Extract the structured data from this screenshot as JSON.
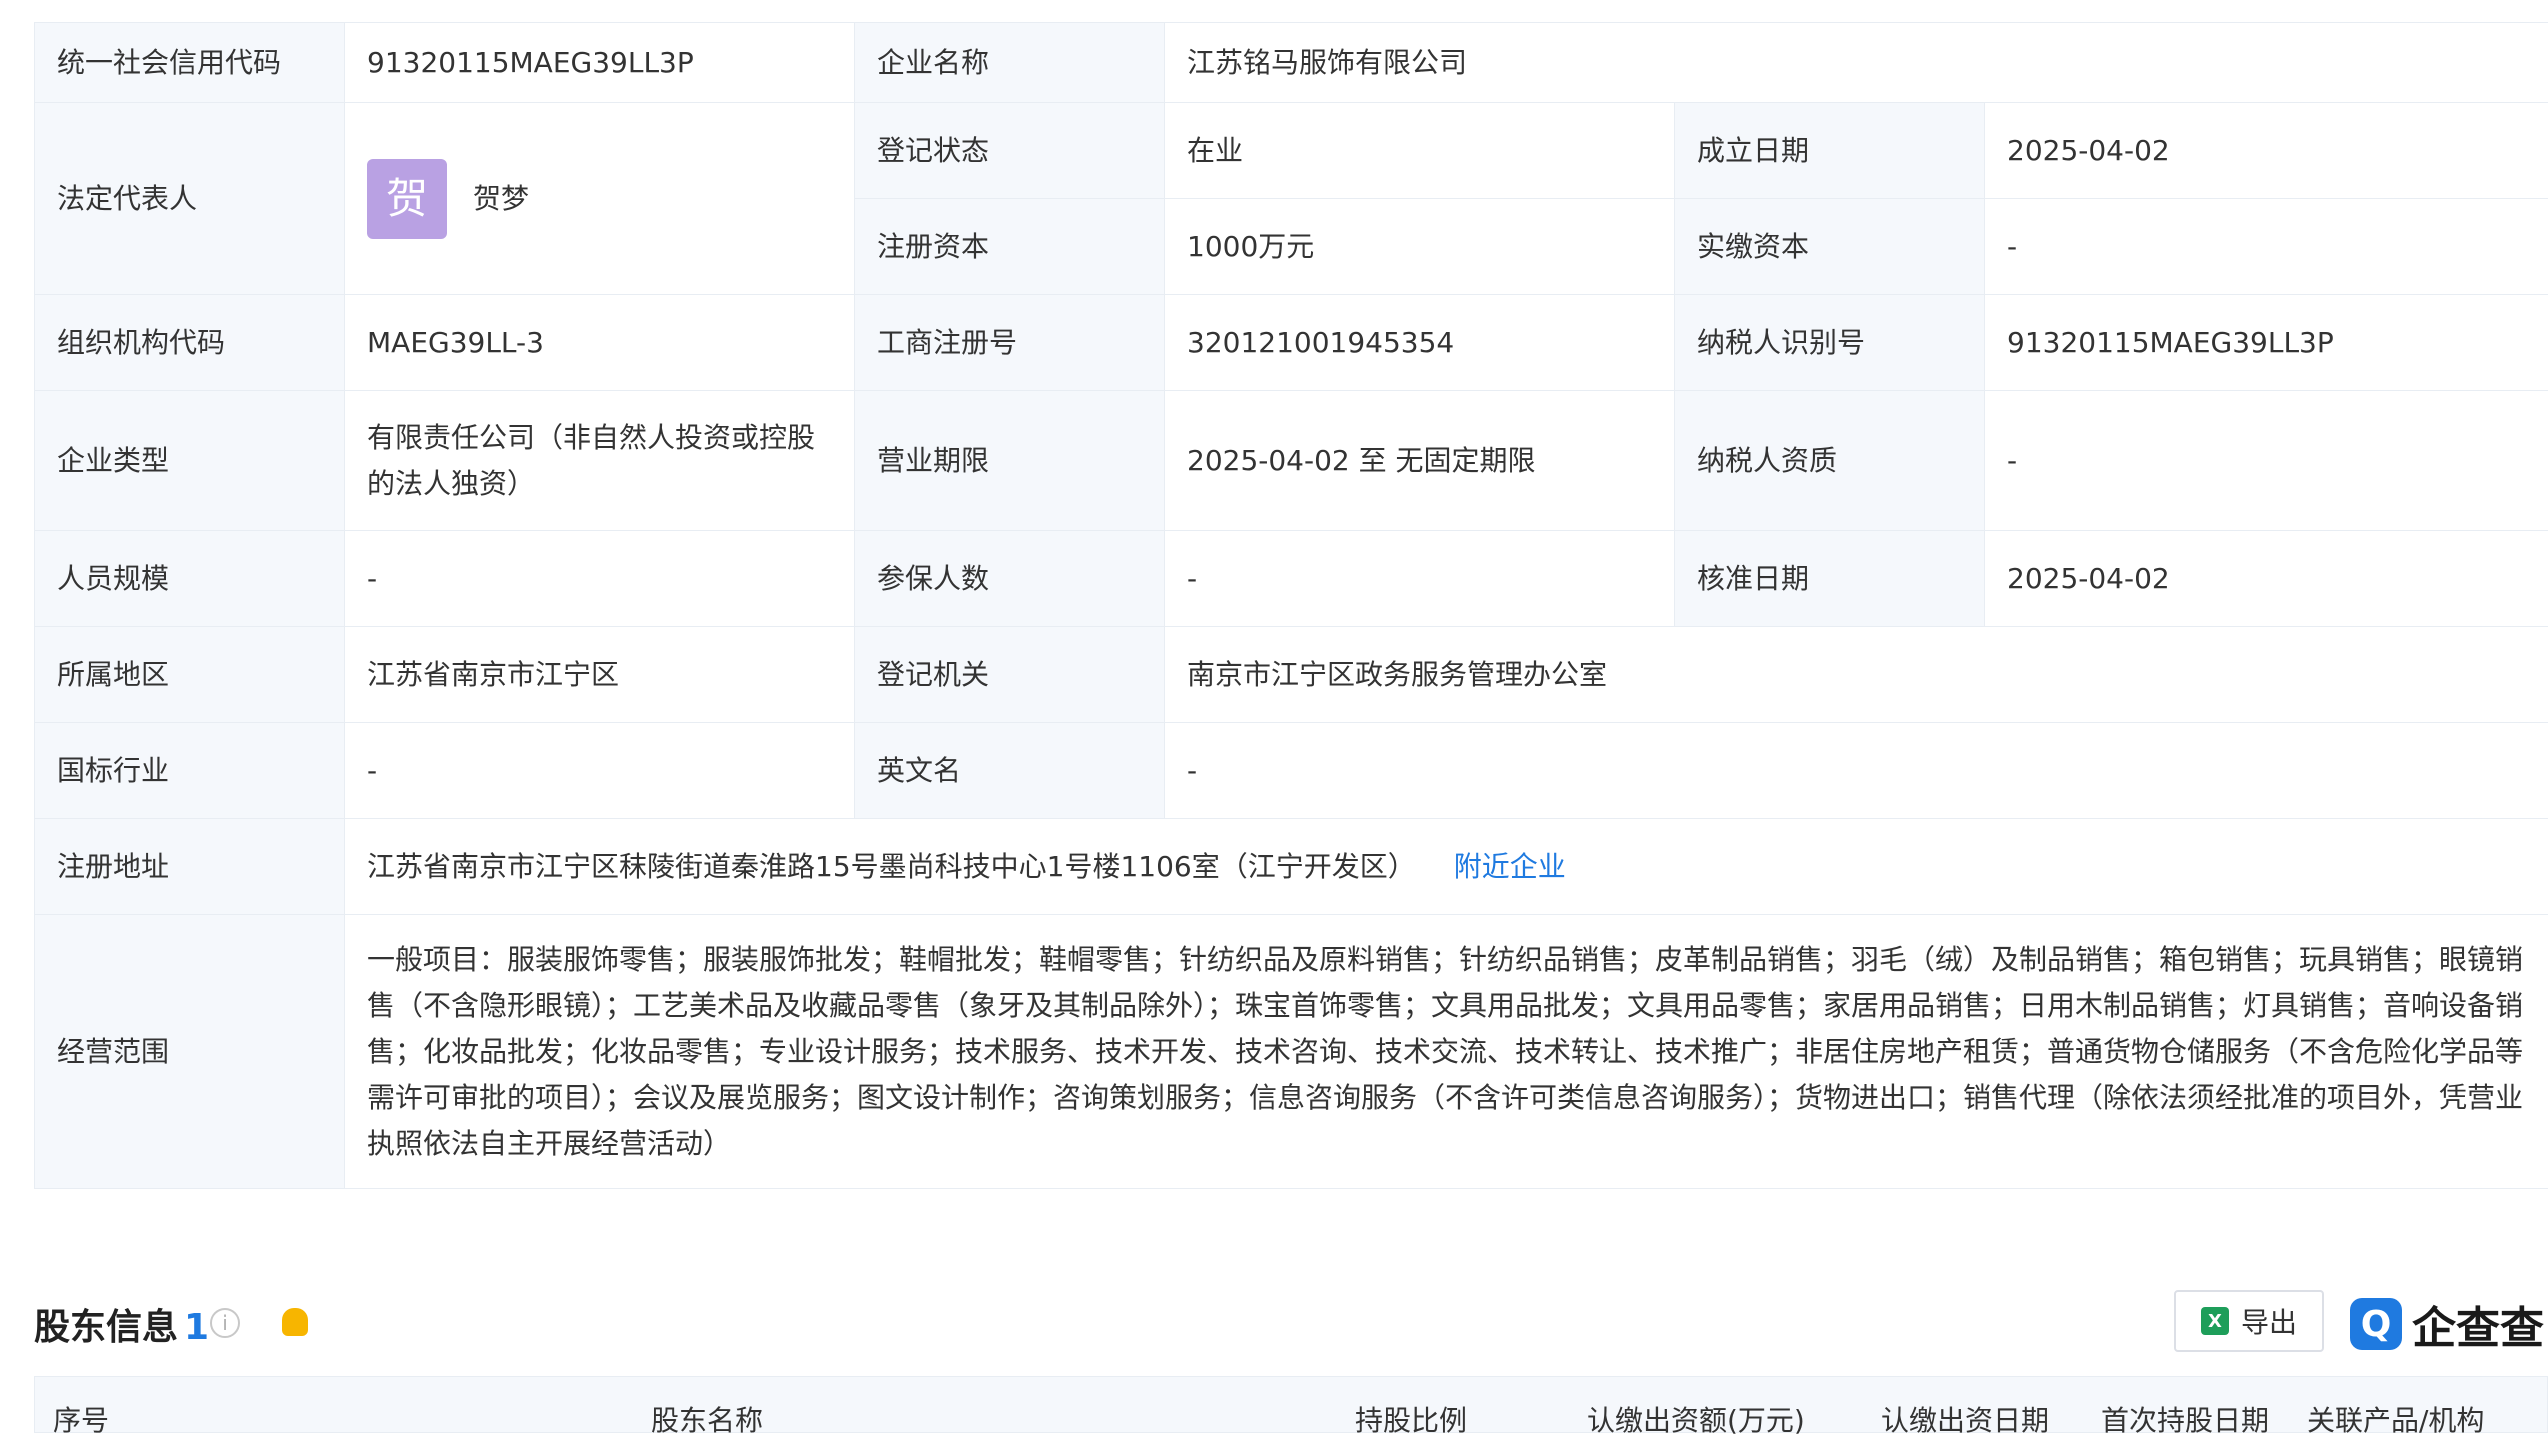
{
  "info": {
    "uscc_label": "统一社会信用代码",
    "uscc": "91320115MAEG39LL3P",
    "company_name_label": "企业名称",
    "company_name": "江苏铭马服饰有限公司",
    "legal_rep_label": "法定代表人",
    "legal_rep_avatar": "贺",
    "legal_rep": "贺梦",
    "reg_status_label": "登记状态",
    "reg_status": "在业",
    "found_date_label": "成立日期",
    "found_date": "2025-04-02",
    "reg_capital_label": "注册资本",
    "reg_capital": "1000万元",
    "paid_capital_label": "实缴资本",
    "paid_capital": "-",
    "org_code_label": "组织机构代码",
    "org_code": "MAEG39LL-3",
    "biz_reg_no_label": "工商注册号",
    "biz_reg_no": "320121001945354",
    "taxpayer_id_label": "纳税人识别号",
    "taxpayer_id": "91320115MAEG39LL3P",
    "company_type_label": "企业类型",
    "company_type": "有限责任公司（非自然人投资或控股的法人独资）",
    "biz_term_label": "营业期限",
    "biz_term": "2025-04-02 至 无固定期限",
    "taxpayer_qual_label": "纳税人资质",
    "taxpayer_qual": "-",
    "staff_size_label": "人员规模",
    "staff_size": "-",
    "insured_label": "参保人数",
    "insured": "-",
    "approve_date_label": "核准日期",
    "approve_date": "2025-04-02",
    "region_label": "所属地区",
    "region": "江苏省南京市江宁区",
    "reg_authority_label": "登记机关",
    "reg_authority": "南京市江宁区政务服务管理办公室",
    "industry_label": "国标行业",
    "industry": "-",
    "english_name_label": "英文名",
    "english_name": "-",
    "address_label": "注册地址",
    "address": "江苏省南京市江宁区秣陵街道秦淮路15号墨尚科技中心1号楼1106室（江宁开发区）",
    "nearby_link": "附近企业",
    "scope_label": "经营范围",
    "scope": "一般项目：服装服饰零售；服装服饰批发；鞋帽批发；鞋帽零售；针纺织品及原料销售；针纺织品销售；皮革制品销售；羽毛（绒）及制品销售；箱包销售；玩具销售；眼镜销售（不含隐形眼镜）；工艺美术品及收藏品零售（象牙及其制品除外）；珠宝首饰零售；文具用品批发；文具用品零售；家居用品销售；日用木制品销售；灯具销售；音响设备销售；化妆品批发；化妆品零售；专业设计服务；技术服务、技术开发、技术咨询、技术交流、技术转让、技术推广；非居住房地产租赁；普通货物仓储服务（不含危险化学品等需许可审批的项目）；会议及展览服务；图文设计制作；咨询策划服务；信息咨询服务（不含许可类信息咨询服务）；货物进出口；销售代理（除依法须经批准的项目外，凭营业执照依法自主开展经营活动）"
  },
  "shareholders": {
    "title": "股东信息",
    "count": "1",
    "export_label": "导出",
    "brand": "企查查",
    "columns": {
      "seq": "序号",
      "name": "股东名称",
      "ratio": "持股比例",
      "sub_capital": "认缴出资额(万元)",
      "sub_date": "认缴出资日期",
      "first_date": "首次持股日期",
      "related": "关联产品/机构"
    }
  }
}
